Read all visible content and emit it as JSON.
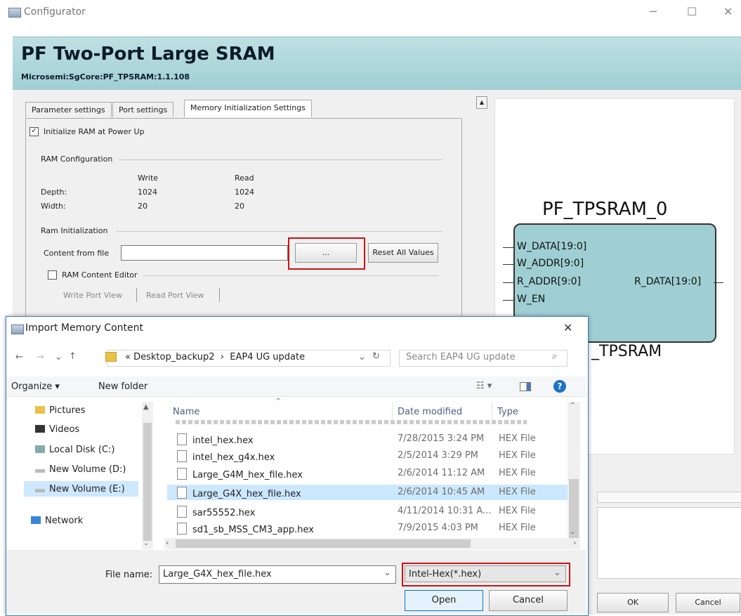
{
  "configurator": {
    "window_title": "Configurator",
    "heading": "PF Two-Port Large SRAM",
    "vlnv": "Microsemi:SgCore:PF_TPSRAM:1.1.108",
    "tabs": [
      "Parameter settings",
      "Port settings",
      "Memory Initialization Settings"
    ],
    "init_ram_label": "Initialize RAM at Power Up",
    "init_ram_checked": true,
    "ram_config_label": "RAM Configuration",
    "col_write": "Write",
    "col_read": "Read",
    "depth_label": "Depth:",
    "depth_write": "1024",
    "depth_read": "1024",
    "width_label": "Width:",
    "width_write": "20",
    "width_read": "20",
    "ram_init_label": "Ram Initialization",
    "content_from_file_label": "Content from file",
    "browse_label": "...",
    "reset_label": "Reset All Values",
    "ram_editor_label": "RAM Content Editor",
    "write_port_view": "Write Port View",
    "read_port_view": "Read Port View",
    "ok_label": "OK",
    "cancel_label": "Cancel"
  },
  "symbol": {
    "title": "PF_TPSRAM_0",
    "subtitle": "_TPSRAM",
    "inputs": [
      "W_DATA[19:0]",
      "W_ADDR[9:0]",
      "R_ADDR[9:0]",
      "W_EN"
    ],
    "outputs": [
      "R_DATA[19:0]"
    ]
  },
  "dialog": {
    "title": "Import Memory Content",
    "breadcrumb_prefix": "«",
    "breadcrumb": [
      "Desktop_backup2",
      "EAP4 UG update"
    ],
    "search_placeholder": "Search EAP4 UG update",
    "organize_label": "Organize ▾",
    "new_folder_label": "New folder",
    "tree": [
      {
        "label": "Pictures",
        "icon": "pictures-folder-icon"
      },
      {
        "label": "Videos",
        "icon": "videos-folder-icon"
      },
      {
        "label": "Local Disk (C:)",
        "icon": "local-disk-icon"
      },
      {
        "label": "New Volume (D:)",
        "icon": "drive-icon"
      },
      {
        "label": "New Volume (E:)",
        "icon": "drive-icon",
        "selected": true
      },
      {
        "label": "Network",
        "icon": "network-icon"
      }
    ],
    "columns": {
      "name": "Name",
      "date": "Date modified",
      "type": "Type"
    },
    "files": [
      {
        "name": "intel_hex.hex",
        "date": "7/28/2015 3:24 PM",
        "type": "HEX File"
      },
      {
        "name": "intel_hex_g4x.hex",
        "date": "2/5/2014 3:29 PM",
        "type": "HEX File"
      },
      {
        "name": "Large_G4M_hex_file.hex",
        "date": "2/6/2014 11:12 AM",
        "type": "HEX File"
      },
      {
        "name": "Large_G4X_hex_file.hex",
        "date": "2/6/2014 10:45 AM",
        "type": "HEX File",
        "selected": true
      },
      {
        "name": "sar55552.hex",
        "date": "4/11/2014 10:31 A...",
        "type": "HEX File"
      },
      {
        "name": "sd1_sb_MSS_CM3_app.hex",
        "date": "7/9/2015 4:03 PM",
        "type": "HEX File"
      }
    ],
    "file_name_label": "File name:",
    "file_name_value": "Large_G4X_hex_file.hex",
    "file_type_value": "Intel-Hex(*.hex)",
    "open_label": "Open",
    "cancel_label": "Cancel",
    "highlight_color": "#d01010",
    "selection_color": "#cce8ff"
  }
}
